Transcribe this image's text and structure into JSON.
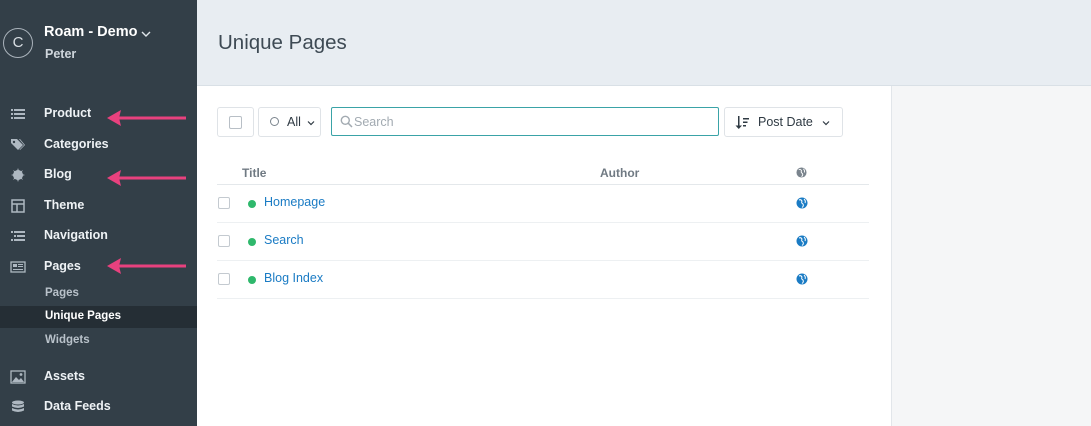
{
  "sidebar": {
    "brand_initial": "C",
    "brand_title": "Roam - Demo",
    "user": "Peter",
    "items": [
      {
        "label": "Product",
        "icon": "list-icon"
      },
      {
        "label": "Categories",
        "icon": "tags-icon"
      },
      {
        "label": "Blog",
        "icon": "badge-icon"
      },
      {
        "label": "Theme",
        "icon": "layout-icon"
      },
      {
        "label": "Navigation",
        "icon": "nav-list-icon"
      },
      {
        "label": "Pages",
        "icon": "newspaper-icon"
      },
      {
        "label": "Assets",
        "icon": "image-icon"
      },
      {
        "label": "Data Feeds",
        "icon": "database-icon"
      }
    ],
    "pages_subitems": [
      {
        "label": "Pages"
      },
      {
        "label": "Unique Pages",
        "active": true
      },
      {
        "label": "Widgets"
      }
    ]
  },
  "header": {
    "title": "Unique Pages"
  },
  "toolbar": {
    "filter_label": "All",
    "search_placeholder": "Search",
    "search_value": "",
    "sort_label": "Post Date"
  },
  "table": {
    "columns": [
      "Title",
      "Author"
    ],
    "rows": [
      {
        "title": "Homepage",
        "author": "",
        "status": "published"
      },
      {
        "title": "Search",
        "author": "",
        "status": "published"
      },
      {
        "title": "Blog Index",
        "author": "",
        "status": "published"
      }
    ]
  },
  "colors": {
    "sidebar_bg": "#333f48",
    "accent_link": "#1a7bc4",
    "status_green": "#2fb86c",
    "annotation_arrow": "#e8417e"
  }
}
